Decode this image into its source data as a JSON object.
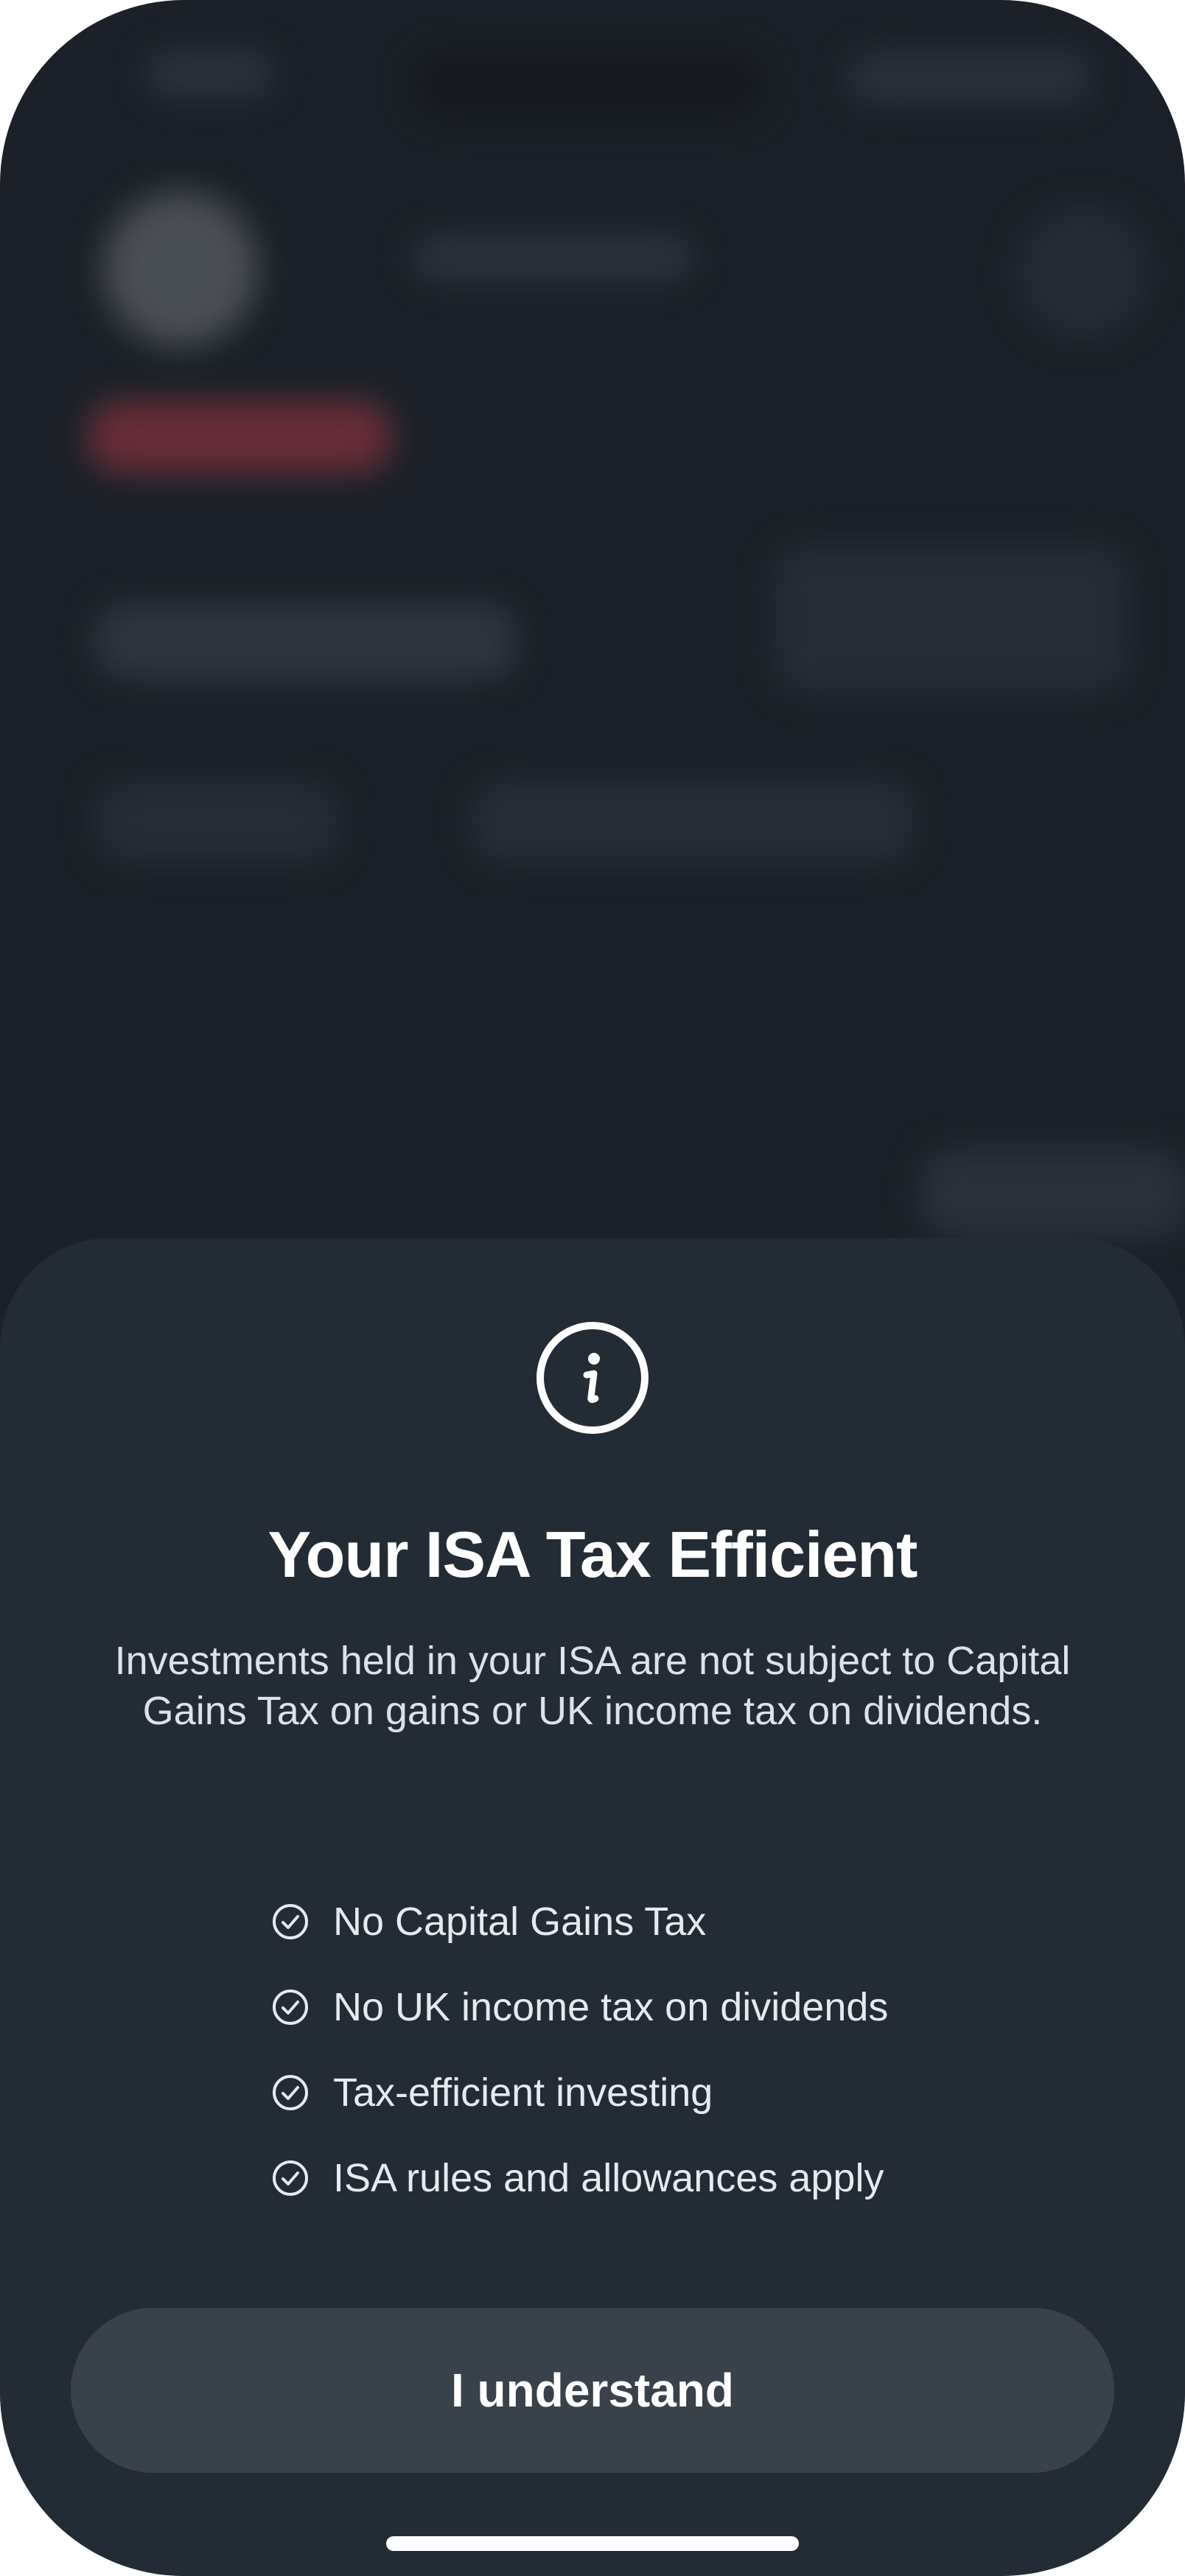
{
  "sheet": {
    "icon": "info-icon",
    "title": "Your ISA Tax Efficient",
    "description": "Investments held in your ISA are not subject to Capital Gains Tax on gains or UK income tax on dividends.",
    "benefits": [
      {
        "icon": "check-circle-icon",
        "label": "No Capital Gains Tax"
      },
      {
        "icon": "check-circle-icon",
        "label": "No UK income tax on dividends"
      },
      {
        "icon": "check-circle-icon",
        "label": "Tax-efficient investing"
      },
      {
        "icon": "check-circle-icon",
        "label": "ISA rules and allowances apply"
      }
    ],
    "button_label": "I understand"
  },
  "colors": {
    "background": "#1c2129",
    "sheet": "#232b35",
    "button": "#39414b",
    "text": "#ffffff"
  }
}
